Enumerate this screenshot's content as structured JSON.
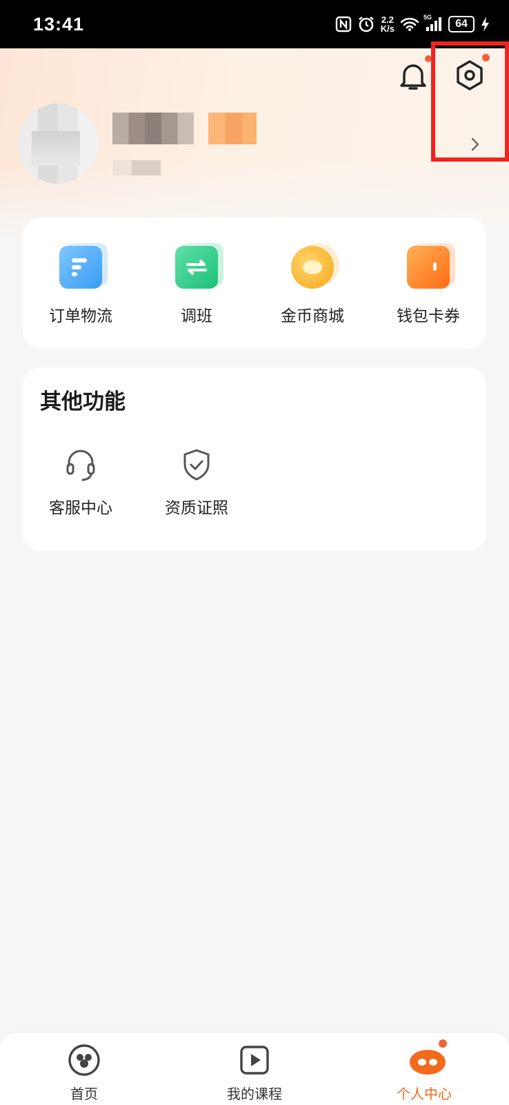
{
  "status_bar": {
    "time": "13:41",
    "network_speed_value": "2.2",
    "network_speed_unit": "K/s",
    "signal_label": "5G",
    "battery": "64",
    "icons": [
      "nfc-icon",
      "alarm-icon",
      "wifi-icon",
      "signal-icon",
      "battery-icon",
      "charging-icon"
    ]
  },
  "header": {
    "icons": [
      "bell-icon",
      "settings-icon",
      "chevron-right-icon"
    ]
  },
  "quick_actions": [
    {
      "label": "订单物流",
      "icon": "order-logistics-icon",
      "color": "#3a9df3"
    },
    {
      "label": "调班",
      "icon": "swap-class-icon",
      "color": "#1cc17a"
    },
    {
      "label": "金币商城",
      "icon": "coin-mall-icon",
      "color": "#f6a61b"
    },
    {
      "label": "钱包卡券",
      "icon": "wallet-icon",
      "color": "#ff6c15"
    }
  ],
  "other_functions": {
    "title": "其他功能",
    "items": [
      {
        "label": "客服中心",
        "icon": "headset-icon"
      },
      {
        "label": "资质证照",
        "icon": "shield-check-icon"
      }
    ]
  },
  "tab_bar": {
    "active_color": "#f26a1b",
    "tabs": [
      {
        "label": "首页",
        "icon": "home-icon",
        "active": false
      },
      {
        "label": "我的课程",
        "icon": "play-course-icon",
        "active": false
      },
      {
        "label": "个人中心",
        "icon": "profile-icon",
        "active": true
      }
    ]
  },
  "highlight_color": "#f2231d"
}
